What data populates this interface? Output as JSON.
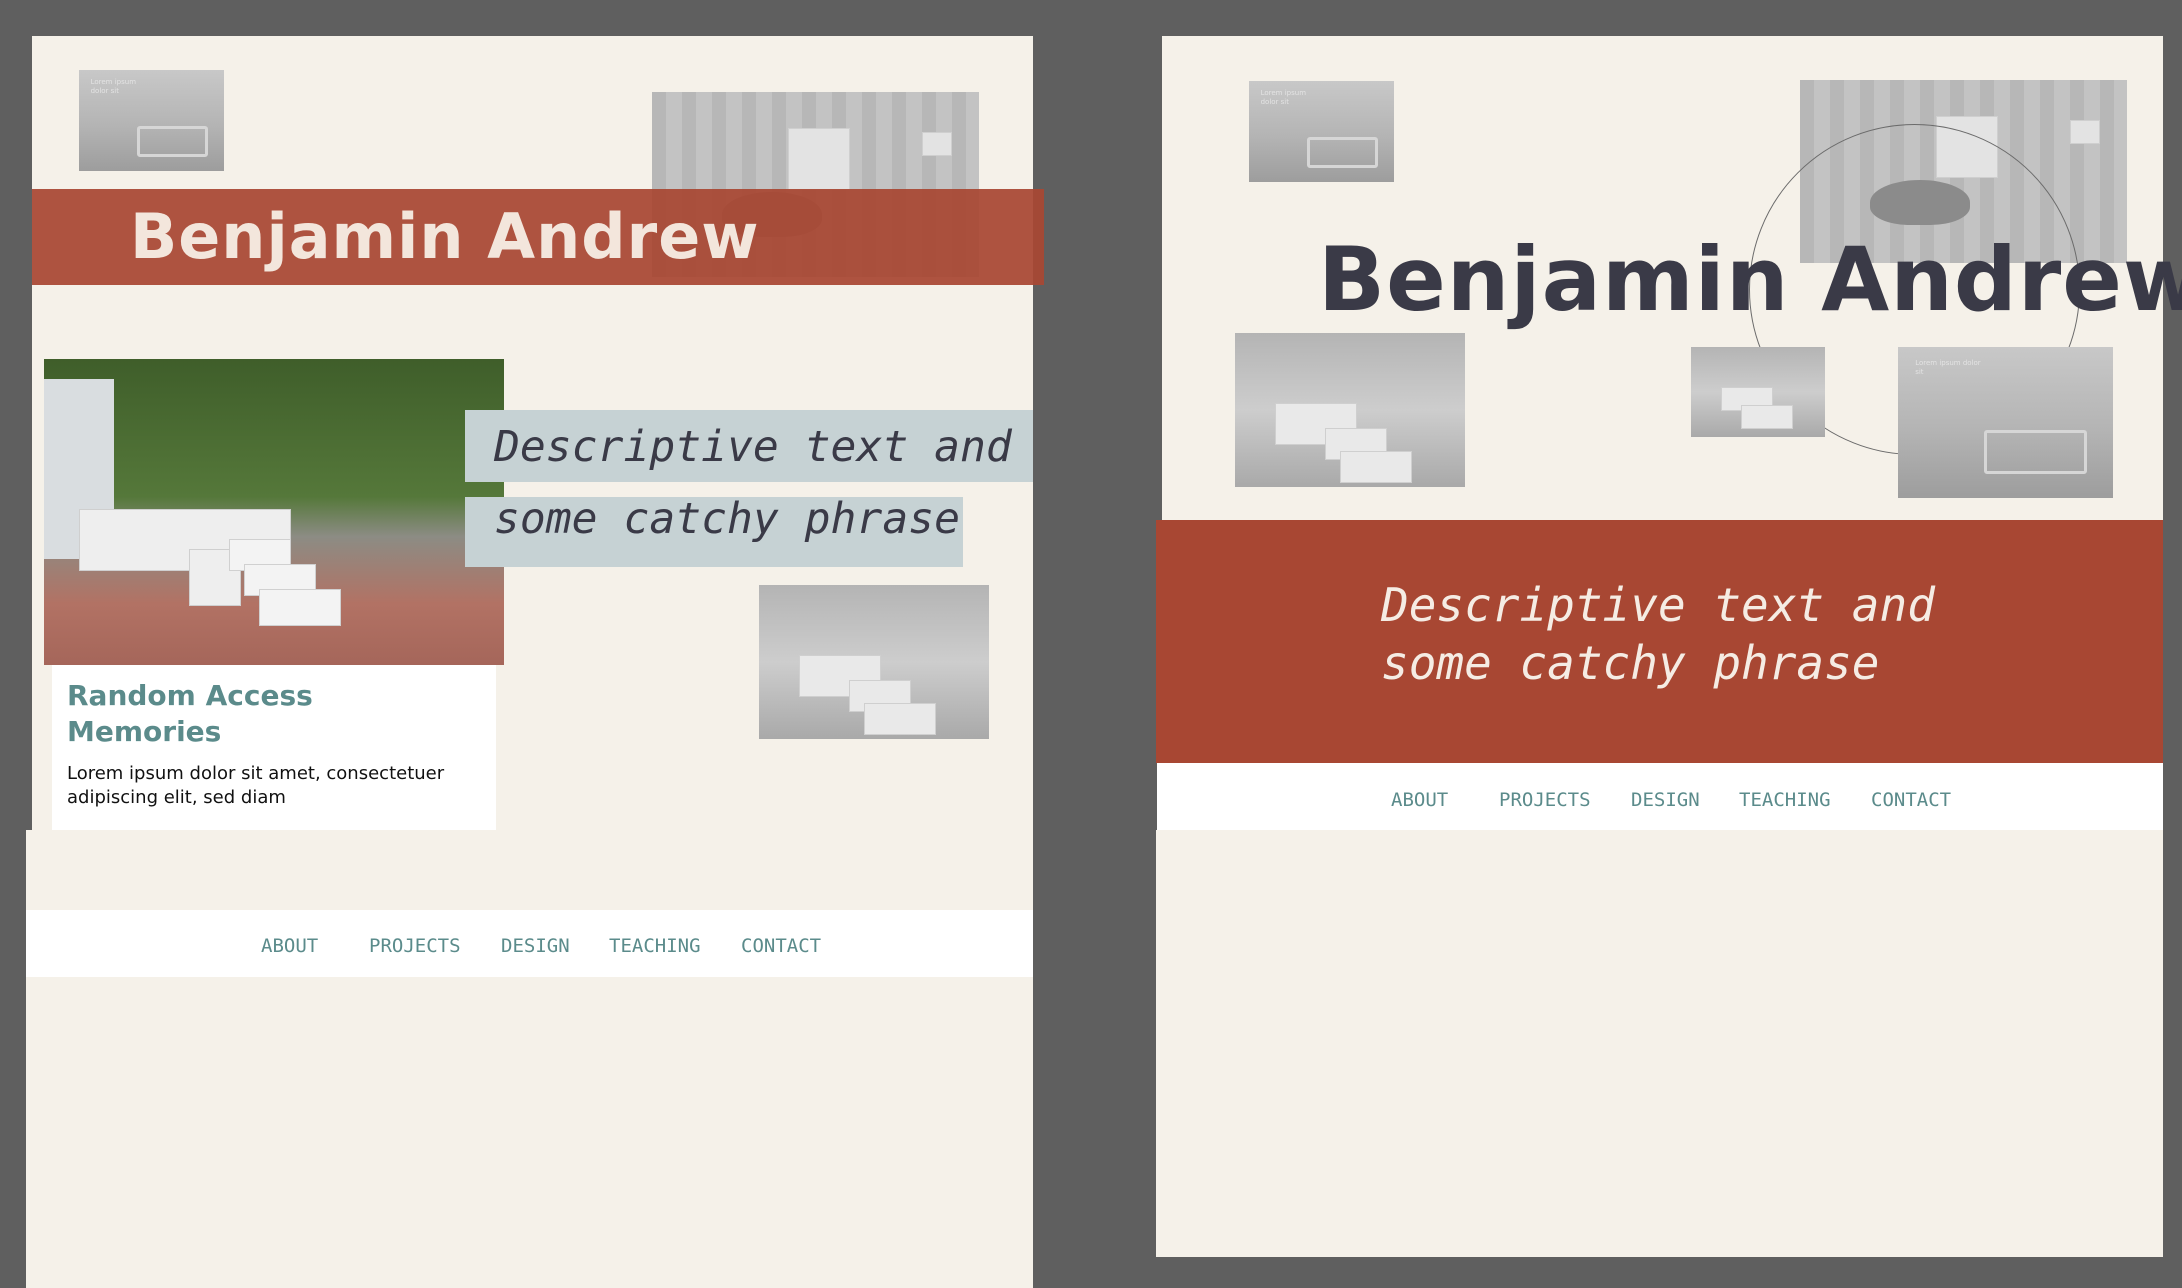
{
  "left_mockup": {
    "name": "Benjamin Andrew",
    "tagline_line1": "Descriptive text and",
    "tagline_line2": "some catchy phrase",
    "card": {
      "title_line1": "Random Access",
      "title_line2": "Memories",
      "body": "Lorem ipsum dolor sit amet, consectetuer adipiscing elit, sed diam"
    },
    "nav": [
      "ABOUT",
      "PROJECTS",
      "DESIGN",
      "TEACHING",
      "CONTACT"
    ],
    "image_caption_tiny": "Lorem ipsum dolor sit"
  },
  "right_mockup": {
    "name": "Benjamin Andrew",
    "tagline_line1": "Descriptive text and",
    "tagline_line2": "some catchy phrase",
    "nav": [
      "ABOUT",
      "PROJECTS",
      "DESIGN",
      "TEACHING",
      "CONTACT"
    ],
    "image_caption_tiny": "Lorem ipsum dolor sit"
  },
  "colors": {
    "background": "#5f5f5f",
    "cream": "#f5f1e9",
    "brick": "#a84733",
    "teal": "#5b8b8b",
    "slate_blue": "#c6d2d4",
    "dark_text": "#3a3a47"
  }
}
